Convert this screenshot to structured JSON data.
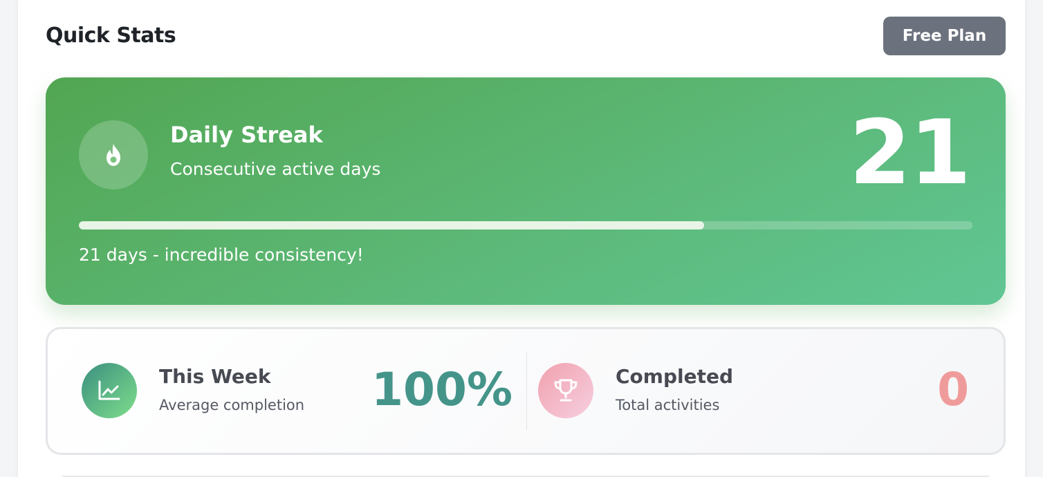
{
  "header": {
    "title": "Quick Stats",
    "plan_badge": "Free Plan"
  },
  "streak": {
    "title": "Daily Streak",
    "subtitle": "Consecutive active days",
    "value": "21",
    "progress_fraction": 0.7,
    "note": "21 days - incredible consistency!",
    "icon": "flame-icon"
  },
  "stats": {
    "this_week": {
      "title": "This Week",
      "subtitle": "Average completion",
      "value": "100%",
      "icon": "trend-chart-icon",
      "color": "#44948a"
    },
    "completed": {
      "title": "Completed",
      "subtitle": "Total activities",
      "value": "0",
      "icon": "trophy-icon",
      "color": "#f09b9b"
    }
  },
  "colors": {
    "streak_gradient_start": "#52a652",
    "streak_gradient_end": "#60c694",
    "badge_background": "#6c727d"
  }
}
